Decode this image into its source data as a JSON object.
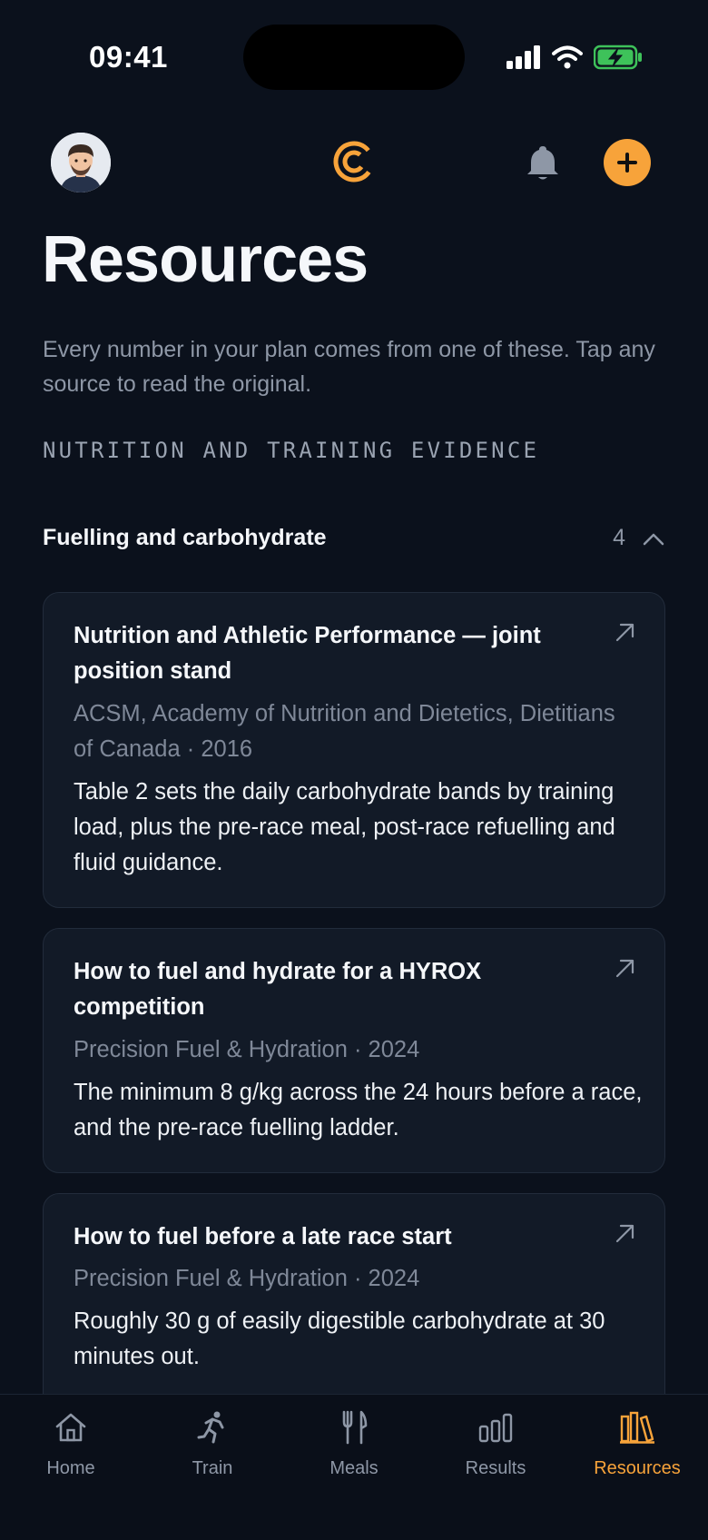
{
  "status_bar": {
    "time": "09:41"
  },
  "header": {
    "avatar": "user-avatar",
    "logo": "app-logo",
    "icons": [
      "bell-icon",
      "plus-icon"
    ]
  },
  "page": {
    "title": "Resources",
    "subtitle": "Every number in your plan comes from one of these. Tap any source to read the original.",
    "section_label": "NUTRITION AND TRAINING EVIDENCE"
  },
  "group": {
    "title": "Fuelling and carbohydrate",
    "count": "4",
    "expanded": true
  },
  "sources": [
    {
      "title": "Nutrition and Athletic Performance — joint position stand",
      "meta": "ACSM, Academy of Nutrition and Dietetics, Dietitians of Canada · 2016",
      "description": "Table 2 sets the daily carbohydrate bands by training load, plus the pre-race meal, post-race refuelling and fluid guidance."
    },
    {
      "title": "How to fuel and hydrate for a HYROX competition",
      "meta": "Precision Fuel & Hydration · 2024",
      "description": "The minimum 8 g/kg across the 24 hours before a race, and the pre-race fuelling ladder."
    },
    {
      "title": "How to fuel before a late race start",
      "meta": "Precision Fuel & Hydration · 2024",
      "description": "Roughly 30 g of easily digestible carbohydrate at 30 minutes out."
    }
  ],
  "tabs": [
    {
      "label": "Home",
      "icon": "home-icon"
    },
    {
      "label": "Train",
      "icon": "runner-icon"
    },
    {
      "label": "Meals",
      "icon": "cutlery-icon"
    },
    {
      "label": "Results",
      "icon": "bars-icon"
    },
    {
      "label": "Resources",
      "icon": "books-icon",
      "active": true
    }
  ],
  "colors": {
    "background": "#0b111c",
    "accent": "#f7a33a",
    "card": "#121a27",
    "muted": "#8e97a6"
  }
}
